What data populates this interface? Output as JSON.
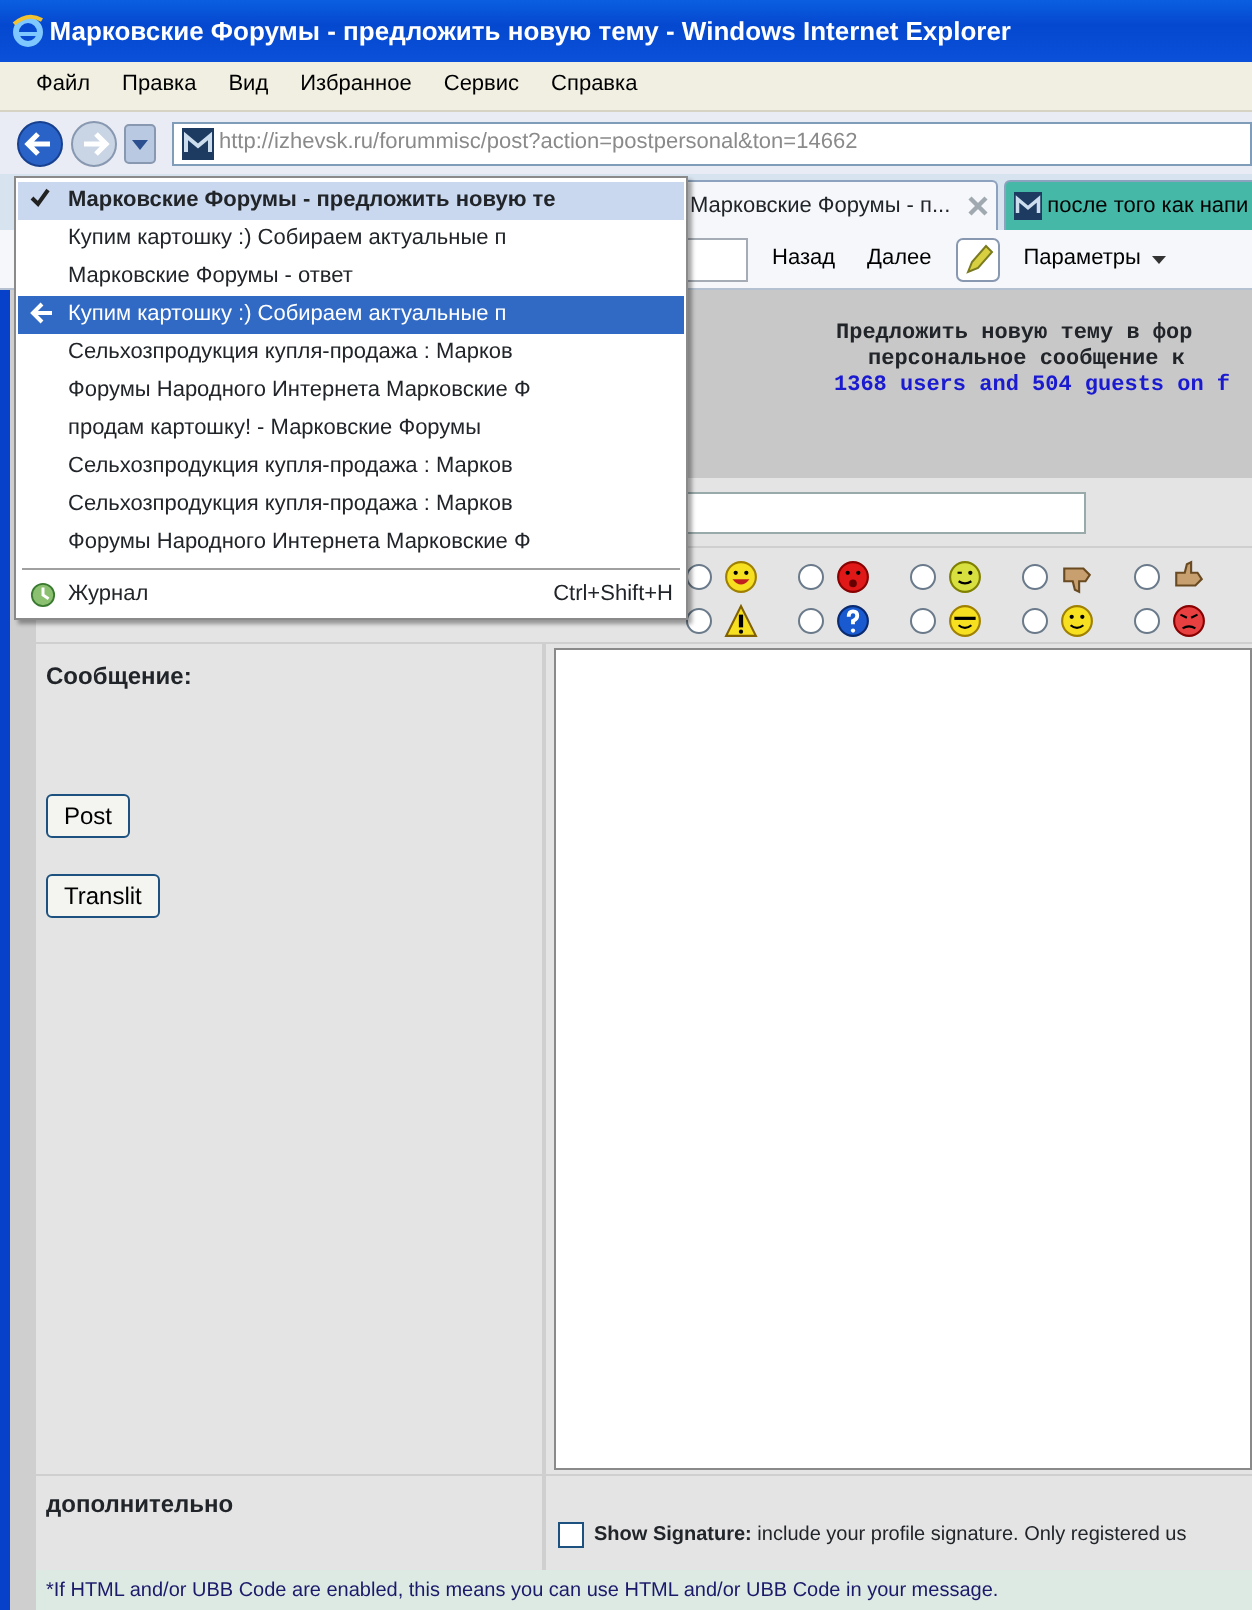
{
  "window": {
    "title": "Марковские Форумы - предложить новую тему - Windows Internet Explorer"
  },
  "menu_bar": [
    "Файл",
    "Правка",
    "Вид",
    "Избранное",
    "Сервис",
    "Справка"
  ],
  "address_bar": {
    "url": "http://izhevsk.ru/forummisc/post?action=postpersonal&ton=14662"
  },
  "tabs": [
    {
      "label": "Марковские Форумы - п...",
      "selected": true
    },
    {
      "label": "после того как напи",
      "selected": false
    }
  ],
  "command_bar": [
    {
      "label": "Назад",
      "kind": "plain"
    },
    {
      "label": "Далее",
      "kind": "plain"
    },
    {
      "label": "Параметры",
      "kind": "menu"
    }
  ],
  "history_menu": {
    "items": [
      {
        "label": "Марковские Форумы - предложить новую те",
        "current": true,
        "highlighted": false
      },
      {
        "label": "Купим картошку :) Собираем актуальные п",
        "current": false,
        "highlighted": false
      },
      {
        "label": "Марковские Форумы - ответ",
        "current": false,
        "highlighted": false
      },
      {
        "label": "Купим картошку :) Собираем актуальные п",
        "current": false,
        "highlighted": true
      },
      {
        "label": "Сельхозпродукция купля-продажа : Марков",
        "current": false,
        "highlighted": false
      },
      {
        "label": "Форумы Народного Интернета Марковские Ф",
        "current": false,
        "highlighted": false
      },
      {
        "label": "продам картошку! - Марковские Форумы",
        "current": false,
        "highlighted": false
      },
      {
        "label": "Сельхозпродукция купля-продажа : Марков",
        "current": false,
        "highlighted": false
      },
      {
        "label": "Сельхозпродукция купля-продажа : Марков",
        "current": false,
        "highlighted": false
      },
      {
        "label": "Форумы Народного Интернета Марковские Ф",
        "current": false,
        "highlighted": false
      }
    ],
    "journal": {
      "label": "Журнал",
      "shortcut": "Ctrl+Shift+H"
    }
  },
  "page": {
    "heading": [
      "Предложить новую тему в фор",
      "персональное сообщение к"
    ],
    "online": "1368 users and 504 guests on f",
    "icons": [
      {
        "kind": "grin",
        "selected": false
      },
      {
        "kind": "surprised",
        "selected": false
      },
      {
        "kind": "wink",
        "selected": false
      },
      {
        "kind": "thumbs-down",
        "selected": false
      },
      {
        "kind": "thumbs-up",
        "selected": false
      },
      {
        "kind": "warning",
        "selected": false
      },
      {
        "kind": "question",
        "selected": false
      },
      {
        "kind": "cool",
        "selected": false
      },
      {
        "kind": "smile",
        "selected": false
      },
      {
        "kind": "angry",
        "selected": false
      }
    ],
    "message_label": "Сообщение:",
    "buttons": [
      "Post",
      "Translit"
    ],
    "extra_label": "дополнительно",
    "signature": {
      "checked": false,
      "text": "**Show Signature:** include your profile signature. Only registered us"
    },
    "footnote": "*If HTML and/or UBB Code are enabled, this means you can use HTML and/or UBB Code in your message."
  }
}
